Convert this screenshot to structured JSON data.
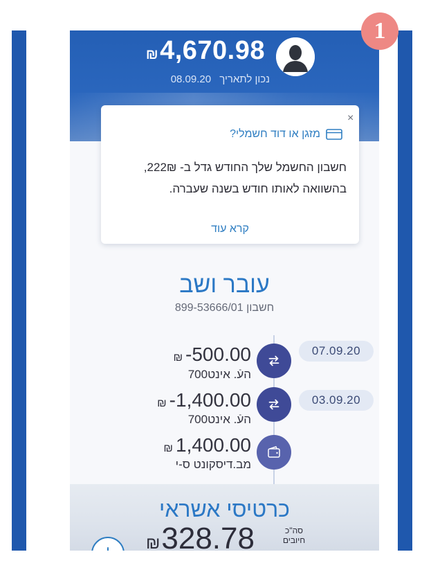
{
  "colors": {
    "side_bar": "#1f58ad",
    "header_blue": "#245fb5",
    "accent_blue": "#2b78c5",
    "tx_icon": "#3f4a97",
    "badge": "#ee8884"
  },
  "step_badge": "1",
  "header": {
    "balance": "4,670.98",
    "currency": "₪",
    "as_of_label": "נכון לתאריך",
    "as_of_date": "08.09.20",
    "avatar_icon": "user-silhouette-icon"
  },
  "tip": {
    "title": "מזגן או דוד חשמלי?",
    "title_icon": "credit-card-icon",
    "body_line1": "חשבון החשמל שלך החודש גדל ב- 222₪,",
    "body_line2": "בהשוואה לאותו חודש בשנה שעברה.",
    "link": "קרא עוד",
    "close": "×"
  },
  "account": {
    "title": "עובר ושב",
    "number_label": "חשבון",
    "number": "899-53666/01"
  },
  "transactions": [
    {
      "amount": "-500.00",
      "currency": "₪",
      "description": "העֿ. אינט700",
      "date": "07.09.20",
      "icon": "transfer-icon"
    },
    {
      "amount": "-1,400.00",
      "currency": "₪",
      "description": "העֿ. אינט700",
      "date": "03.09.20",
      "icon": "transfer-icon"
    },
    {
      "amount": "1,400.00",
      "currency": "₪",
      "description": "מב.דיסקונט ס-י",
      "date": "",
      "icon": "wallet-icon"
    }
  ],
  "credit_cards": {
    "title": "כרטיסי אשראי",
    "total_label_line1": "סה\"כ",
    "total_label_line2": "חיובים",
    "amount": "328.78",
    "currency": "₪",
    "expand_icon": "arrow-down-circle-icon"
  }
}
